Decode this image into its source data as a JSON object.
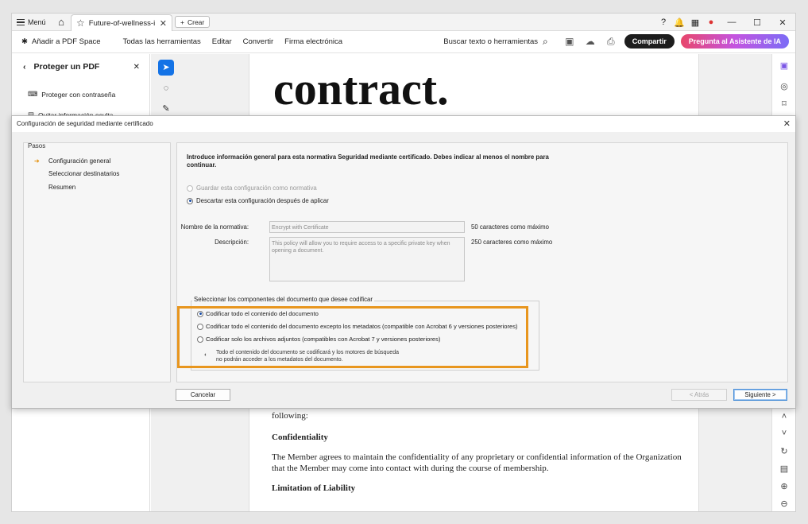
{
  "tabbar": {
    "menu_label": "Menú",
    "tab_title": "Future-of-wellness-i...",
    "new_tab_label": "Crear"
  },
  "toolbar": {
    "add_space": "Añadir a PDF Space",
    "all_tools": "Todas las herramientas",
    "edit": "Editar",
    "convert": "Convertir",
    "esign": "Firma electrónica",
    "search": "Buscar texto o herramientas",
    "share": "Compartir",
    "ai": "Pregunta al Asistente de IA"
  },
  "left_pane": {
    "title": "Proteger un PDF",
    "items": [
      {
        "label": "Proteger con contraseña"
      },
      {
        "label": "Quitar información oculta"
      }
    ]
  },
  "document": {
    "big_word": "contract.",
    "following": "following:",
    "heading1": "Confidentiality",
    "para1_line1": "The Member agrees to maintain the confidentiality of any proprietary or confidential information of the Organization",
    "para1_line2": "that the Member may come into contact with during the course of membership.",
    "heading2": "Limitation of Liability"
  },
  "dialog": {
    "title": "Configuración de seguridad mediante certificado",
    "steps_title": "Pasos",
    "steps": [
      {
        "label": "Configuración general"
      },
      {
        "label": "Seleccionar destinatarios"
      },
      {
        "label": "Resumen"
      }
    ],
    "intro_line1": "Introduce información general para esta normativa Seguridad mediante certificado. Debes indicar al menos el nombre para",
    "intro_line2": "continuar.",
    "save_option": "Guardar esta configuración como normativa",
    "discard_option": "Descartar esta configuración después de aplicar",
    "name_label": "Nombre de la normativa:",
    "name_value": "Encrypt with Certificate",
    "name_note": "50 caracteres como máximo",
    "desc_label": "Descripción:",
    "desc_value": "This policy will allow you to require access to a specific private key when opening a document.",
    "desc_note": "250 caracteres como máximo",
    "group_label": "Seleccionar los componentes del documento que desee codificar",
    "options": [
      {
        "label": "Codificar todo el contenido del documento",
        "selected": true
      },
      {
        "label": "Codificar todo el contenido del documento excepto los metadatos (compatible con Acrobat 6 y versiones posteriores)",
        "selected": false
      },
      {
        "label": "Codificar solo los archivos adjuntos (compatibles con Acrobat 7 y versiones posteriores)",
        "selected": false
      }
    ],
    "info_line1": "Todo el contenido del documento se codificará y los motores de búsqueda",
    "info_line2": "no podrán acceder a los metadatos del documento.",
    "cancel": "Cancelar",
    "back": "< Atrás",
    "next": "Siguiente >",
    "highlight_color": "#e8961e"
  }
}
